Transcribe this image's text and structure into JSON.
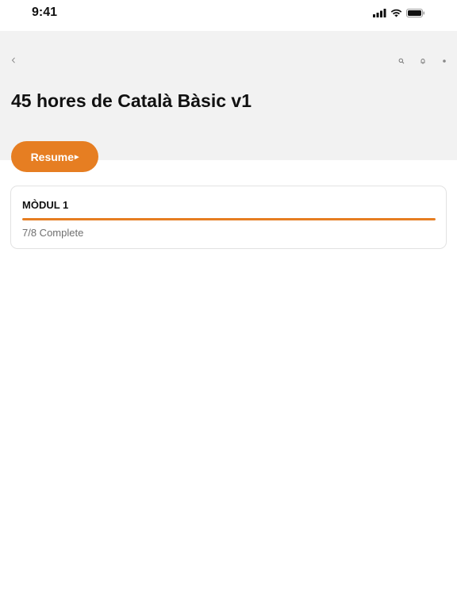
{
  "status_bar": {
    "time": "9:41",
    "icons": [
      "cellular-signal-icon",
      "wifi-icon",
      "battery-icon"
    ]
  },
  "header": {
    "background_color": "#f2f2f2",
    "back_icon": "chevron-left-icon",
    "actions": [
      "search-icon",
      "bell-icon",
      "more-icon"
    ],
    "title": "45 hores de Català Bàsic v1"
  },
  "resume_button": {
    "label": "Resume",
    "icon": "play-icon",
    "color": "#e67e22"
  },
  "modules": [
    {
      "title": "MÒDUL 1",
      "status": "7/8 Complete",
      "progress": 1.0,
      "progress_color": "#e67e22"
    }
  ]
}
